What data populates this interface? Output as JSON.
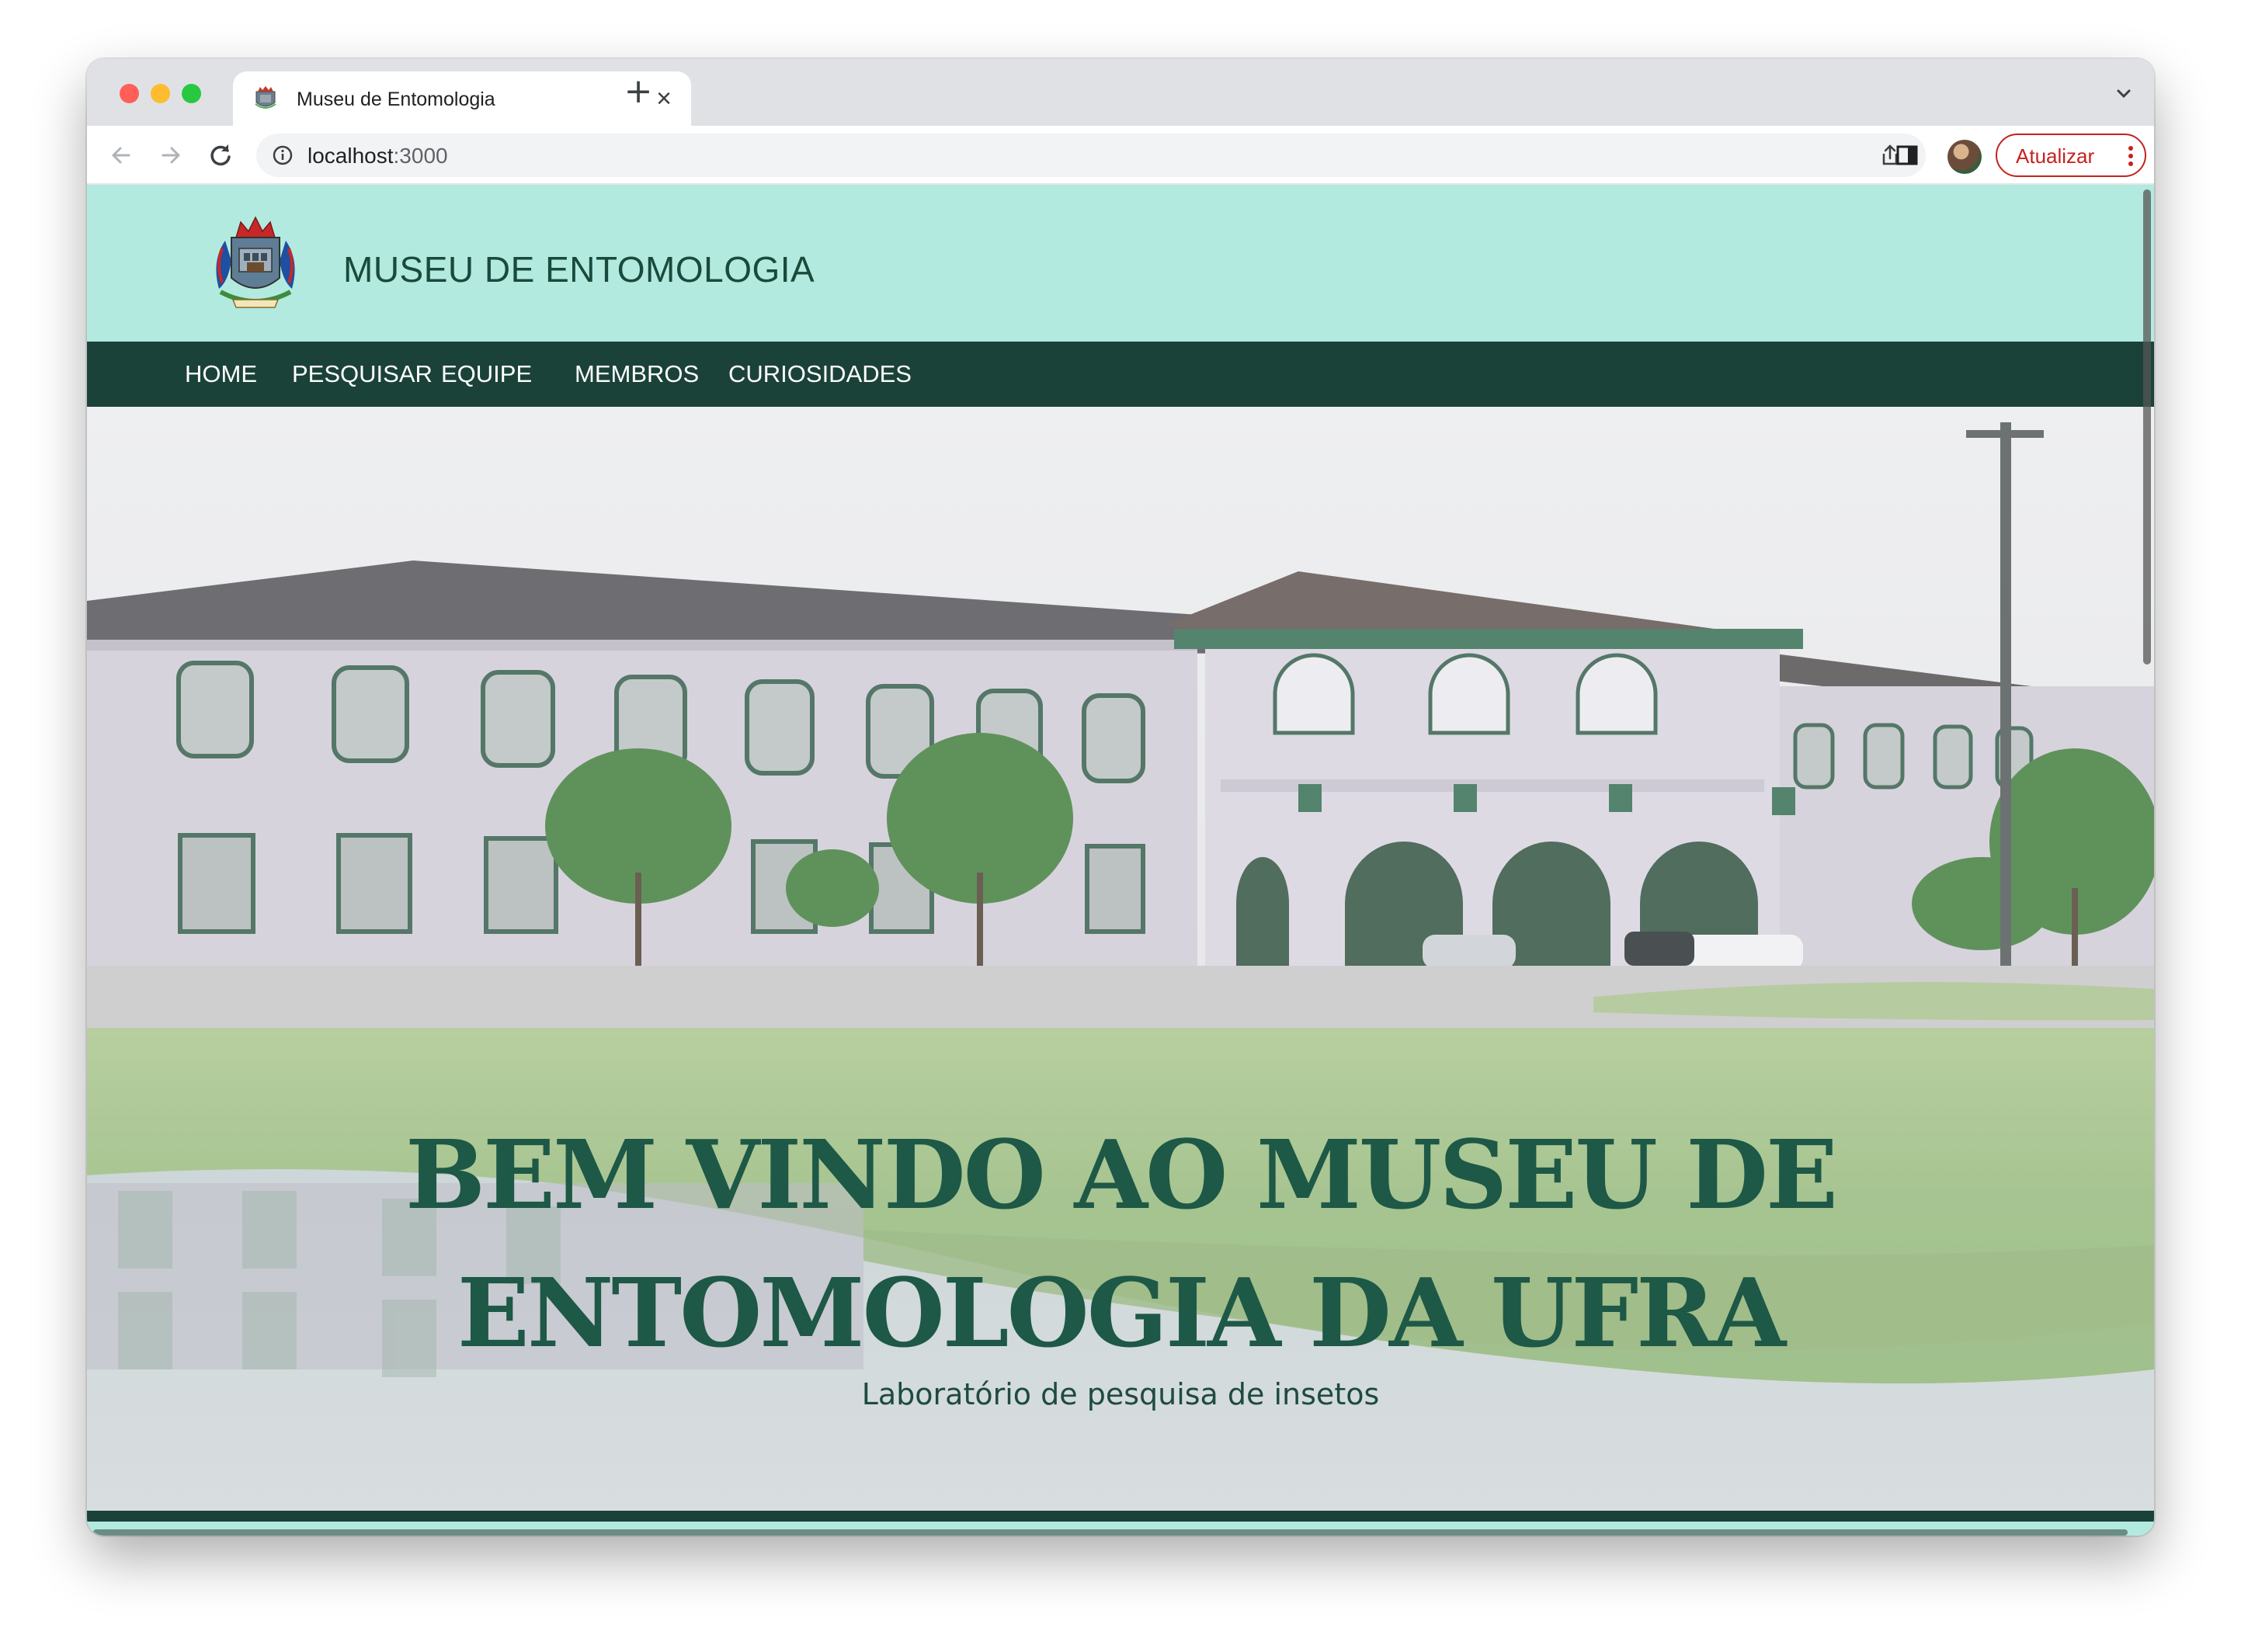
{
  "browser": {
    "tab_title": "Museu de Entomologia",
    "url_host": "localhost",
    "url_port": ":3000",
    "update_label": "Atualizar",
    "new_tab_label": "+",
    "close_tab_label": "×"
  },
  "site": {
    "title": "MUSEU DE ENTOMOLOGIA",
    "nav": [
      "HOME",
      "PESQUISAR",
      "EQUIPE",
      "MEMBROS",
      "CURIOSIDADES"
    ]
  },
  "hero": {
    "title_line1": "BEM VINDO AO MUSEU DE",
    "title_line2": "ENTOMOLOGIA DA UFRA",
    "subtitle": "Laboratório de pesquisa de insetos"
  },
  "colors": {
    "header_bg": "#b2eadf",
    "nav_bg": "#1b4239",
    "title_color": "#1e5846"
  }
}
